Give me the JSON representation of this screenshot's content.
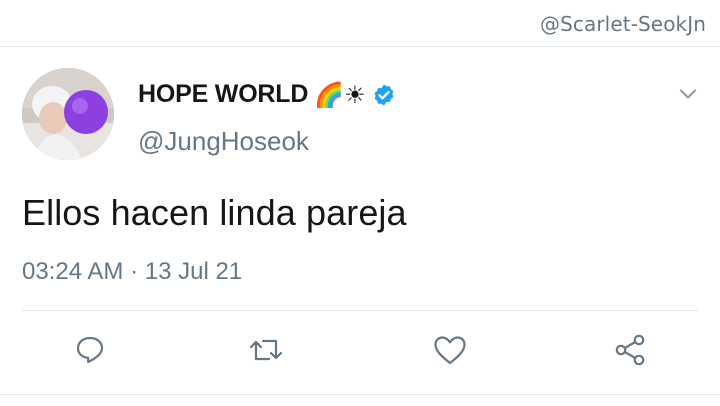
{
  "watermark": "@Scarlet-SeokJn",
  "tweet": {
    "display_name": "HOPE WORLD",
    "name_emojis": "🌈☀",
    "verified": true,
    "handle": "@JungHoseok",
    "text": "Ellos hacen linda pareja",
    "time": "03:24 AM",
    "separator": "·",
    "date": "13 Jul 21"
  },
  "icons": {
    "menu": "chevron-down-icon",
    "reply": "reply-icon",
    "retweet": "retweet-icon",
    "like": "heart-icon",
    "share": "share-icon",
    "verified": "verified-badge-icon"
  },
  "colors": {
    "secondary_text": "#657786",
    "verified_blue": "#1da1f2",
    "icon_gray": "#657786",
    "divider": "#e1e8ed"
  }
}
